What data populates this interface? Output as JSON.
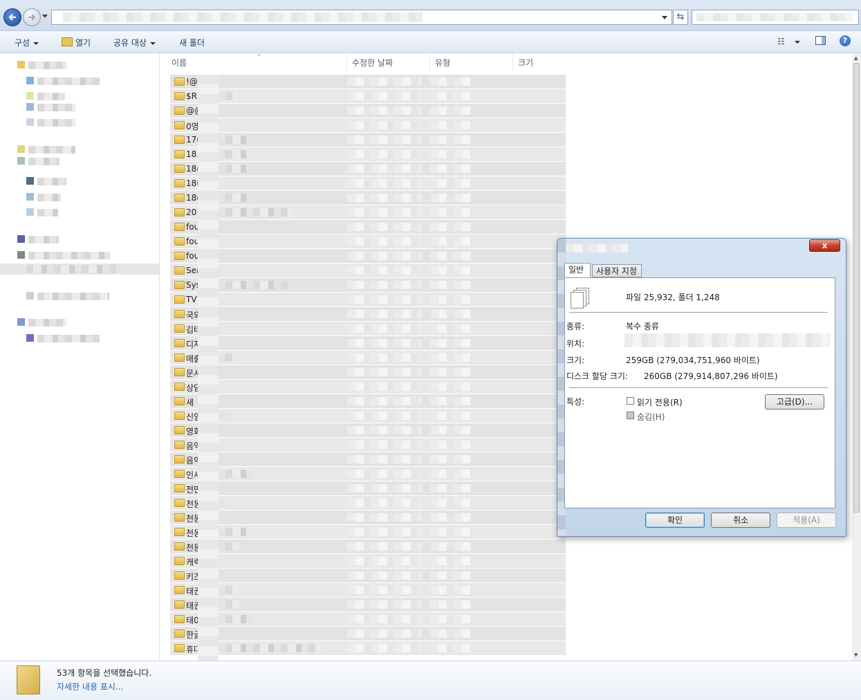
{
  "explorer": {
    "toolbar": {
      "organize": "구성",
      "open": "열기",
      "share": "공유 대상",
      "new_folder": "새 폴더"
    },
    "columns": {
      "name": "이름",
      "date": "수정한 날짜",
      "type": "유형",
      "size": "크기"
    },
    "rows": [
      {
        "name": "!@p"
      },
      {
        "name": "$RE"
      },
      {
        "name": "@@"
      },
      {
        "name": "0영"
      },
      {
        "name": "17("
      },
      {
        "name": "18."
      },
      {
        "name": "18("
      },
      {
        "name": "18("
      },
      {
        "name": "18("
      },
      {
        "name": "201"
      },
      {
        "name": "fou"
      },
      {
        "name": "fou"
      },
      {
        "name": "fou"
      },
      {
        "name": "Sea"
      },
      {
        "name": "Sys"
      },
      {
        "name": "TV"
      },
      {
        "name": "국외"
      },
      {
        "name": "김태"
      },
      {
        "name": "디자"
      },
      {
        "name": "매출"
      },
      {
        "name": "문서"
      },
      {
        "name": "상담"
      },
      {
        "name": "새"
      },
      {
        "name": "신임"
      },
      {
        "name": "영화"
      },
      {
        "name": "음악"
      },
      {
        "name": "음악"
      },
      {
        "name": "인사"
      },
      {
        "name": "전만"
      },
      {
        "name": "천동"
      },
      {
        "name": "천동"
      },
      {
        "name": "천동"
      },
      {
        "name": "천동"
      },
      {
        "name": "캐릭"
      },
      {
        "name": "키즈"
      },
      {
        "name": "태권"
      },
      {
        "name": "태권"
      },
      {
        "name": "태0"
      },
      {
        "name": "한글"
      },
      {
        "name": "휴대"
      }
    ],
    "details": {
      "count": "53개 항목을 선택했습니다.",
      "link": "자세한 내용 표시..."
    }
  },
  "dialog": {
    "close": "x",
    "tabs": {
      "general": "일반",
      "custom": "사용자 지정"
    },
    "summary": "파일 25,932, 폴더 1,248",
    "type_label": "종류:",
    "type_value": "복수 종류",
    "location_label": "위치:",
    "size_label": "크기:",
    "size_value": "259GB (279,034,751,960 바이트)",
    "disk_label": "디스크 할당 크기:",
    "disk_value": "260GB (279,914,807,296 바이트)",
    "attr_label": "특성:",
    "readonly": "읽기 전용(R)",
    "hidden": "숨김(H)",
    "advanced": "고급(D)...",
    "ok": "확인",
    "cancel": "취소",
    "apply": "적용(A)"
  },
  "icons": {
    "back": "back-arrow-icon",
    "forward": "forward-arrow-icon",
    "refresh": "refresh-icon",
    "folder": "folder-icon",
    "help": "help-icon"
  }
}
